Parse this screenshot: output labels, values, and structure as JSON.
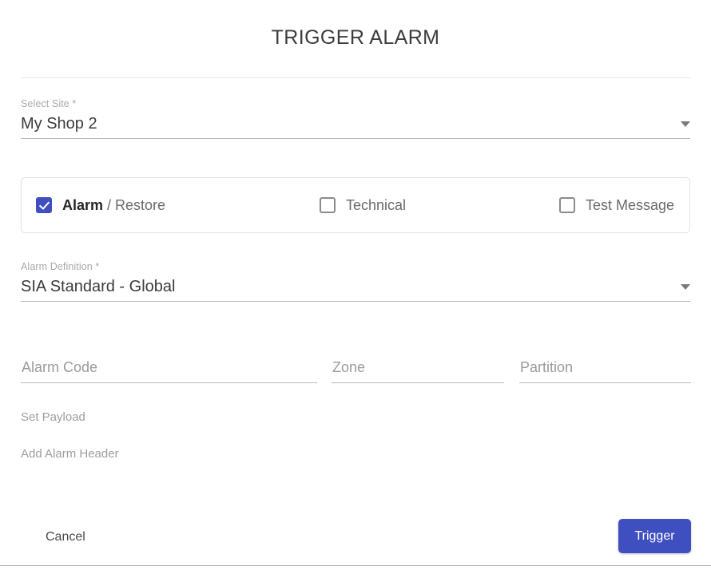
{
  "dialog": {
    "title": "TRIGGER ALARM"
  },
  "select_site": {
    "label": "Select Site *",
    "value": "My Shop 2",
    "caret_icon": "chevron-down-icon"
  },
  "alarm_types": {
    "items": [
      {
        "id": "alarm-restore",
        "label_strong": "Alarm",
        "label_light": " / Restore",
        "checked": true
      },
      {
        "id": "technical",
        "label_strong": "",
        "label_light": "Technical",
        "checked": false
      },
      {
        "id": "test-message",
        "label_strong": "",
        "label_light": "Test Message",
        "checked": false
      }
    ]
  },
  "alarm_definition": {
    "label": "Alarm Definition *",
    "value": "SIA Standard - Global",
    "caret_icon": "chevron-down-icon"
  },
  "fields": {
    "alarm_code": {
      "placeholder": "Alarm Code",
      "value": ""
    },
    "zone": {
      "placeholder": "Zone",
      "value": ""
    },
    "partition": {
      "placeholder": "Partition",
      "value": ""
    }
  },
  "expanders": {
    "set_payload": "Set Payload",
    "add_alarm_header": "Add Alarm Header"
  },
  "footer": {
    "cancel_label": "Cancel",
    "trigger_label": "Trigger"
  },
  "colors": {
    "accent": "#3f4fc0",
    "label_gray": "#a8a8a8",
    "placeholder_gray": "#9b9b9b",
    "text": "#3b3b3b",
    "border": "#b9b9b9",
    "panel_border": "#e2e2e2"
  }
}
